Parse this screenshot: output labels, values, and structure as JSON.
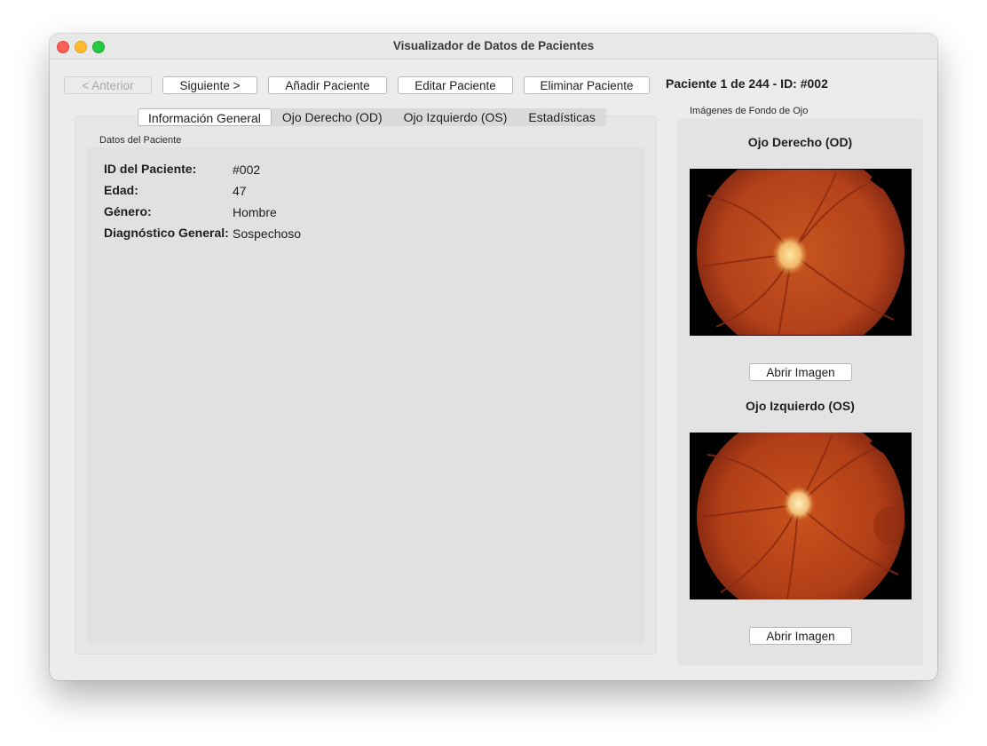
{
  "window": {
    "title": "Visualizador de Datos de Pacientes"
  },
  "toolbar": {
    "prev_label": "< Anterior",
    "next_label": "Siguiente >",
    "add_label": "Añadir Paciente",
    "edit_label": "Editar Paciente",
    "delete_label": "Eliminar Paciente",
    "status": "Paciente 1 de 244 - ID: #002"
  },
  "tabs": [
    {
      "label": "Información General",
      "active": true
    },
    {
      "label": "Ojo Derecho (OD)",
      "active": false
    },
    {
      "label": "Ojo Izquierdo (OS)",
      "active": false
    },
    {
      "label": "Estadísticas",
      "active": false
    }
  ],
  "patient": {
    "group_title": "Datos del Paciente",
    "fields": [
      {
        "label": "ID del Paciente:",
        "value": "#002"
      },
      {
        "label": "Edad:",
        "value": "47"
      },
      {
        "label": "Género:",
        "value": "Hombre"
      },
      {
        "label": "Diagnóstico General:",
        "value": "Sospechoso"
      }
    ]
  },
  "images": {
    "group_title": "Imágenes de Fondo de Ojo",
    "right_eye": {
      "title": "Ojo Derecho (OD)",
      "open_label": "Abrir Imagen"
    },
    "left_eye": {
      "title": "Ojo Izquierdo (OS)",
      "open_label": "Abrir Imagen"
    }
  },
  "colors": {
    "close": "#fe5f57",
    "minimize": "#febc2e",
    "maximize": "#28c840",
    "fundus": "#b8421c"
  }
}
